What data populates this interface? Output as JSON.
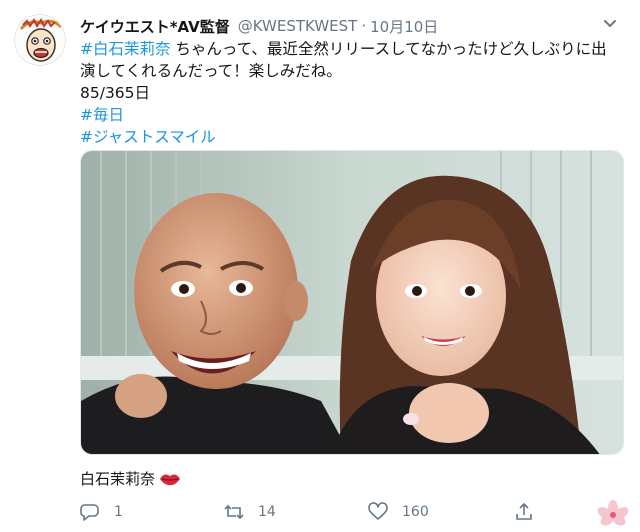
{
  "tweet": {
    "author": {
      "display_name": "ケイウエスト*AV監督",
      "handle": "@KWESTKWEST",
      "separator": "·",
      "date": "10月10日",
      "avatar_icon": "cartoon-face-avatar"
    },
    "body": {
      "line1_hashtag": "#白石茉莉奈",
      "line1_text": " ちゃんって、最近全然リリースしてなかったけど久しぶりに出",
      "line2_text": "演してくれるんだって！楽しみだね。",
      "line3_text": "85/365日",
      "hashtag2": "#毎日",
      "hashtag3": "#ジャストスマイル"
    },
    "caption": "白石茉莉奈",
    "actions": {
      "reply_count": "1",
      "retweet_count": "14",
      "like_count": "160"
    },
    "colors": {
      "link": "#1b95e0",
      "muted": "#657786",
      "text": "#14171a"
    }
  }
}
